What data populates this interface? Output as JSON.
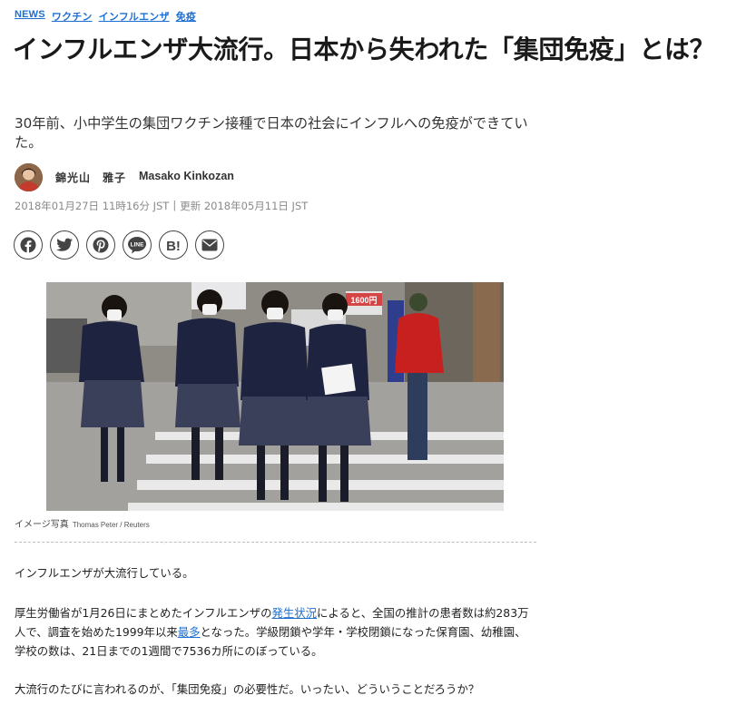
{
  "tags": [
    "NEWS",
    "ワクチン",
    "インフルエンザ",
    "免疫"
  ],
  "article": {
    "title": "インフルエンザ大流行。日本から失われた「集団免疫」とは？",
    "subtitle": "30年前、小中学生の集団ワクチン接種で日本の社会にインフルへの免疫ができていた。",
    "author_jp": "錦光山　雅子",
    "author_en": "Masako Kinkozan",
    "published": "2018年01月27日 11時16分 JST",
    "separator": "|",
    "updated": "更新 2018年05月11日 JST"
  },
  "share": {
    "icons": [
      "facebook-icon",
      "twitter-icon",
      "pinterest-icon",
      "line-icon",
      "hatena-bookmark-icon",
      "email-icon"
    ],
    "line_label": "LINE",
    "hatena_label": "B!"
  },
  "photo": {
    "caption": "イメージ写真",
    "credit": "Thomas Peter / Reuters",
    "sign_price": "1600円"
  },
  "body": {
    "p1": "インフルエンザが大流行している。",
    "p2_a": "厚生労働省が1月26日にまとめたインフルエンザの",
    "p2_link1": "発生状況",
    "p2_b": "によると、全国の推計の患者数は約283万人で、調査を始めた1999年以来",
    "p2_link2": "最多",
    "p2_c": "となった。学級閉鎖や学年・学校閉鎖になった保育園、幼稚園、学校の数は、21日までの1週間で7536カ所にのぼっている。",
    "p3": "大流行のたびに言われるのが、「集団免疫」の必要性だ。いったい、どういうことだろうか？"
  },
  "colors": {
    "link": "#1f6fd1",
    "title": "#1a1a1a",
    "meta": "#8a8a8a"
  }
}
